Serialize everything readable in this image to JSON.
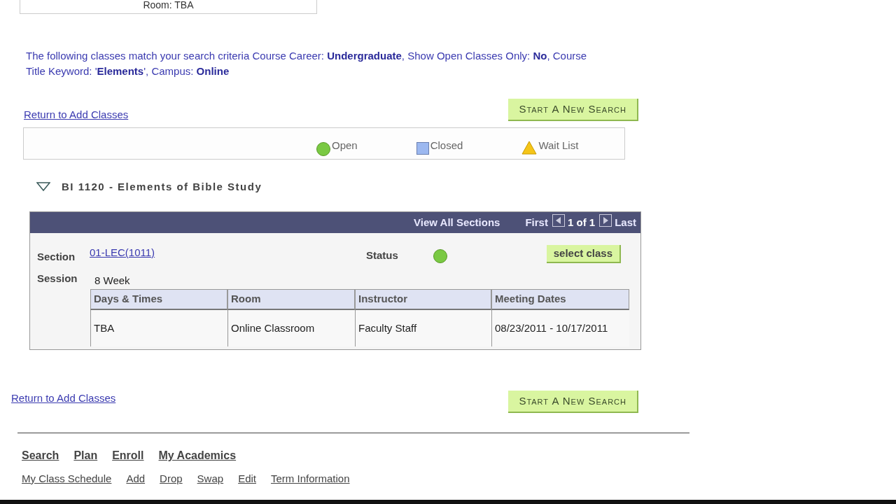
{
  "previous_box": {
    "text": "Room:  TBA"
  },
  "criteria": "The following classes match your search criteria Course Career: **Undergraduate**,  Show Open Classes Only: **No**,  Course Title Keyword: '**Elements**',  Campus: **Online**",
  "return_link_top": "Return to Add Classes",
  "new_search_top": "Start A New Search",
  "legend": [
    {
      "kind": "open",
      "label": "Open"
    },
    {
      "kind": "closed",
      "label": "Closed"
    },
    {
      "kind": "waitlist",
      "label": "Wait List"
    }
  ],
  "course": {
    "expanded": true,
    "title": "BI 1120 - Elements of Bible Study",
    "nav": {
      "view_all": "View All Sections",
      "first": "First",
      "count": "1 of 1",
      "last": "Last"
    },
    "section_label": "Section",
    "section": "01-LEC(1011)",
    "status_label": "Status",
    "status": {
      "kind": "open"
    },
    "select_button": "select class",
    "session_label": "Session",
    "session": "8 Week",
    "columns": [
      "Days & Times",
      "Room",
      "Instructor",
      "Meeting Dates"
    ],
    "rows": [
      [
        "TBA",
        "Online Classroom",
        "Faculty Staff",
        "08/23/2011 - 10/17/2011"
      ]
    ]
  },
  "return_link_bottom": "Return to Add Classes",
  "new_search_bottom": "Start A New Search",
  "nav_main": [
    "Search",
    "Plan",
    "Enroll",
    "My Academics"
  ],
  "nav_sub": [
    "My Class Schedule",
    "Add",
    "Drop",
    "Swap",
    "Edit",
    "Term Information"
  ]
}
